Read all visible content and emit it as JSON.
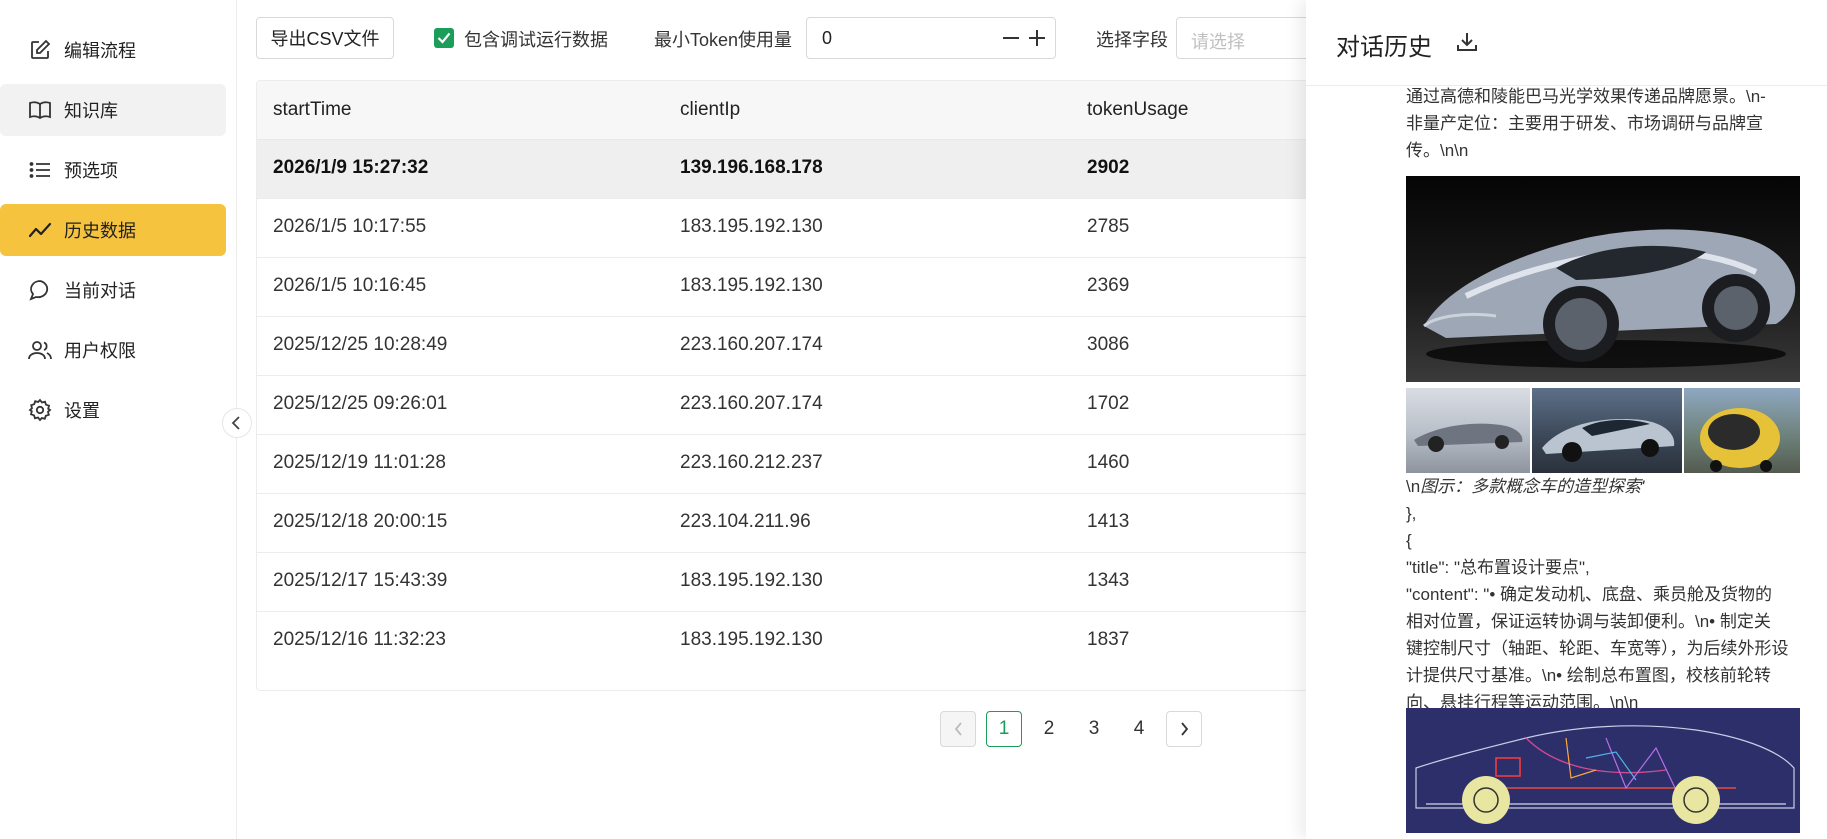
{
  "sidebar": {
    "items": [
      {
        "label": "编辑流程",
        "icon": "edit-icon"
      },
      {
        "label": "知识库",
        "icon": "book-icon"
      },
      {
        "label": "预选项",
        "icon": "list-icon"
      },
      {
        "label": "历史数据",
        "icon": "trend-icon"
      },
      {
        "label": "当前对话",
        "icon": "chat-icon"
      },
      {
        "label": "用户权限",
        "icon": "users-icon"
      },
      {
        "label": "设置",
        "icon": "gear-icon"
      }
    ]
  },
  "toolbar": {
    "export_label": "导出CSV文件",
    "include_debug_label": "包含调试运行数据",
    "include_debug_checked": true,
    "min_token_label": "最小Token使用量",
    "min_token_value": "0",
    "field_label": "选择字段",
    "field_placeholder": "请选择"
  },
  "table": {
    "columns": [
      "startTime",
      "clientIp",
      "tokenUsage"
    ],
    "rows": [
      [
        "2026/1/9 15:27:32",
        "139.196.168.178",
        "2902"
      ],
      [
        "2026/1/5 10:17:55",
        "183.195.192.130",
        "2785"
      ],
      [
        "2026/1/5 10:16:45",
        "183.195.192.130",
        "2369"
      ],
      [
        "2025/12/25 10:28:49",
        "223.160.207.174",
        "3086"
      ],
      [
        "2025/12/25 09:26:01",
        "223.160.207.174",
        "1702"
      ],
      [
        "2025/12/19 11:01:28",
        "223.160.212.237",
        "1460"
      ],
      [
        "2025/12/18 20:00:15",
        "223.104.211.96",
        "1413"
      ],
      [
        "2025/12/17 15:43:39",
        "183.195.192.130",
        "1343"
      ],
      [
        "2025/12/16 11:32:23",
        "183.195.192.130",
        "1837"
      ]
    ]
  },
  "pagination": {
    "pages": [
      "1",
      "2",
      "3",
      "4"
    ],
    "current": "1"
  },
  "drawer": {
    "title": "对话历史",
    "lines": {
      "l1": "通过高德和陵能巴马光学效果传递品牌愿景。\\n-",
      "l2": "非量产定位：主要用于研发、市场调研与品牌宣",
      "l3": "传。\\n\\n",
      "caption_prefix": "\\n",
      "caption": "图示：多款概念车的造型探索'",
      "c1": "},",
      "c2": "{",
      "c3": "\"title\": \"总布置设计要点\",",
      "c4": "\"content\": \"• 确定发动机、底盘、乘员舱及货物的",
      "c5": "相对位置，保证运转协调与装卸便利。\\n• 制定关",
      "c6": "键控制尺寸（轴距、轮距、车宽等），为后续外形设",
      "c7": "计提供尺寸基准。\\n• 绘制总布置图，校核前轮转",
      "c8": "向、悬挂行程等运动范围。\\n\\n"
    }
  }
}
